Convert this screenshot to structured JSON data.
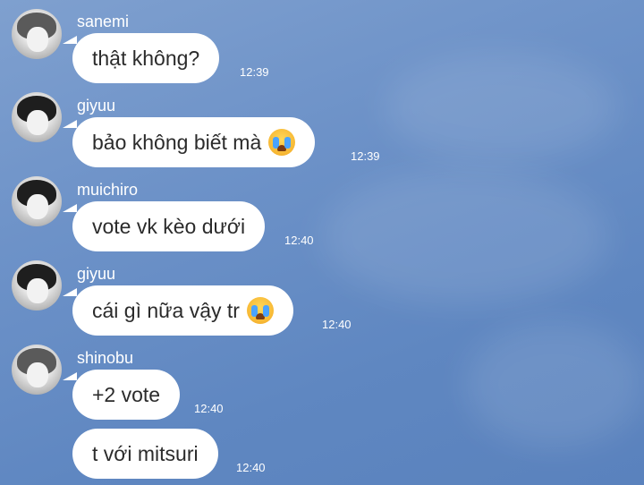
{
  "messages": [
    {
      "sender": "sanemi",
      "text": "thật không?",
      "time": "12:39",
      "emoji": ""
    },
    {
      "sender": "giyuu",
      "text": "bảo không biết mà",
      "time": "12:39",
      "emoji": "loudly-crying-face-emoji"
    },
    {
      "sender": "muichiro",
      "text": "vote vk kèo dưới",
      "time": "12:40",
      "emoji": ""
    },
    {
      "sender": "giyuu",
      "text": "cái gì nữa vậy tr",
      "time": "12:40",
      "emoji": "loudly-crying-face-emoji"
    },
    {
      "sender": "shinobu",
      "text": "+2 vote",
      "time": "12:40",
      "emoji": ""
    },
    {
      "sender": "",
      "text": "t với mitsuri",
      "time": "12:40",
      "emoji": ""
    }
  ]
}
